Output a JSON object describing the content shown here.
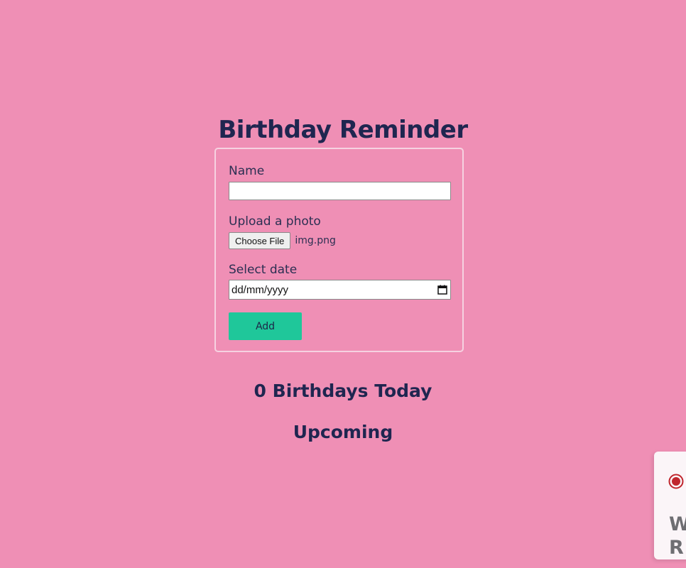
{
  "page": {
    "title": "Birthday Reminder"
  },
  "form": {
    "name_label": "Name",
    "name_value": "",
    "photo_label": "Upload a photo",
    "file_button_label": "Choose File",
    "file_name": "img.png",
    "date_label": "Select date",
    "date_placeholder": "dd/mm/yyyy",
    "add_button_label": "Add"
  },
  "summary": {
    "today_text": "0 Birthdays Today",
    "upcoming_heading": "Upcoming"
  },
  "widget": {
    "text_line1": "W",
    "text_line2": "R",
    "icon": "record-icon"
  },
  "colors": {
    "background": "#ef8fb5",
    "heading": "#1f2650",
    "accent": "#1fc79a",
    "record_red": "#c0262d"
  }
}
